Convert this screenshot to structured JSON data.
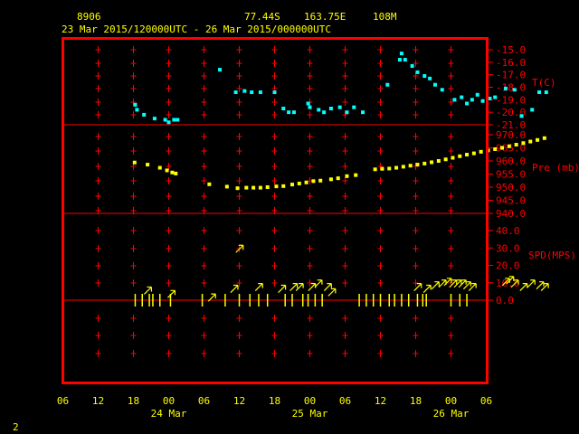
{
  "header": {
    "station_id": "8906",
    "lat": "77.44S",
    "lon": "163.75E",
    "elevation": "108M",
    "time_range": "23 Mar 2015/120000UTC - 26 Mar 2015/000000UTC"
  },
  "page_number": "2",
  "colors": {
    "frame": "#ff0000",
    "text": "#ffff00",
    "temperature": "#00ffff",
    "pressure": "#ffff00",
    "wind": "#ffff00",
    "background": "#000000"
  },
  "x_axis": {
    "hour_ticks": [
      "06",
      "12",
      "18",
      "00",
      "06",
      "12",
      "18",
      "00",
      "06",
      "12",
      "18",
      "00",
      "06"
    ],
    "day_labels": [
      "24 Mar",
      "25 Mar",
      "26 Mar"
    ]
  },
  "chart_data": [
    {
      "type": "scatter",
      "panel": "temperature",
      "ylabel": "T(C)",
      "ylim": [
        -21,
        -15
      ],
      "yticks": [
        "-15.0",
        "-16.0",
        "-17.0",
        "-18.0",
        "-19.0",
        "-20.0",
        "-21.0"
      ],
      "x_unit": "hours from 23 Mar 2015 06 UTC",
      "points": [
        [
          12.3,
          -19.4
        ],
        [
          12.6,
          -19.8
        ],
        [
          13.8,
          -20.2
        ],
        [
          15.6,
          -20.5
        ],
        [
          17.4,
          -20.6
        ],
        [
          18.0,
          -20.8
        ],
        [
          18.9,
          -20.6
        ],
        [
          19.5,
          -20.6
        ],
        [
          26.7,
          -16.6
        ],
        [
          29.4,
          -18.4
        ],
        [
          30.9,
          -18.3
        ],
        [
          32.1,
          -18.4
        ],
        [
          33.6,
          -18.4
        ],
        [
          36.0,
          -18.4
        ],
        [
          37.5,
          -19.7
        ],
        [
          38.4,
          -20.0
        ],
        [
          39.3,
          -20.0
        ],
        [
          41.7,
          -19.3
        ],
        [
          42.0,
          -19.6
        ],
        [
          43.5,
          -19.8
        ],
        [
          44.4,
          -20.0
        ],
        [
          45.6,
          -19.7
        ],
        [
          47.1,
          -19.6
        ],
        [
          48.3,
          -20.0
        ],
        [
          49.5,
          -19.6
        ],
        [
          51.0,
          -20.0
        ],
        [
          55.2,
          -17.8
        ],
        [
          57.3,
          -15.8
        ],
        [
          57.6,
          -15.3
        ],
        [
          58.2,
          -15.8
        ],
        [
          59.4,
          -16.3
        ],
        [
          60.3,
          -16.8
        ],
        [
          61.5,
          -17.1
        ],
        [
          62.4,
          -17.3
        ],
        [
          63.3,
          -17.8
        ],
        [
          64.5,
          -18.2
        ],
        [
          66.6,
          -19.0
        ],
        [
          67.8,
          -18.8
        ],
        [
          68.7,
          -19.3
        ],
        [
          69.6,
          -19.0
        ],
        [
          70.5,
          -18.6
        ],
        [
          71.4,
          -19.1
        ],
        [
          72.6,
          -18.9
        ],
        [
          73.5,
          -18.8
        ],
        [
          75.3,
          -18.1
        ],
        [
          76.8,
          -18.2
        ],
        [
          78.0,
          -20.3
        ],
        [
          79.8,
          -19.8
        ],
        [
          81.0,
          -18.4
        ],
        [
          82.2,
          -18.4
        ]
      ]
    },
    {
      "type": "scatter",
      "panel": "pressure",
      "ylabel": "Pre (mb)",
      "ylim": [
        940,
        970
      ],
      "yticks": [
        "970.0",
        "965.0",
        "960.0",
        "955.0",
        "950.0",
        "945.0",
        "940.0"
      ],
      "x_unit": "hours from 23 Mar 2015 06 UTC",
      "points": [
        [
          12.2,
          959.4
        ],
        [
          14.4,
          958.6
        ],
        [
          16.5,
          957.4
        ],
        [
          17.7,
          956.4
        ],
        [
          18.6,
          955.6
        ],
        [
          19.2,
          955.2
        ],
        [
          24.9,
          951.1
        ],
        [
          27.9,
          950.2
        ],
        [
          29.7,
          949.6
        ],
        [
          31.2,
          949.8
        ],
        [
          32.4,
          949.8
        ],
        [
          33.6,
          949.8
        ],
        [
          34.8,
          950.0
        ],
        [
          36.3,
          950.3
        ],
        [
          37.5,
          950.4
        ],
        [
          39.0,
          951.0
        ],
        [
          40.2,
          951.4
        ],
        [
          41.4,
          951.8
        ],
        [
          42.6,
          952.3
        ],
        [
          43.8,
          952.5
        ],
        [
          45.6,
          953.0
        ],
        [
          46.8,
          953.4
        ],
        [
          48.3,
          954.2
        ],
        [
          49.8,
          954.6
        ],
        [
          53.1,
          956.8
        ],
        [
          54.3,
          957.0
        ],
        [
          55.5,
          957.1
        ],
        [
          56.7,
          957.4
        ],
        [
          57.9,
          957.8
        ],
        [
          59.1,
          958.2
        ],
        [
          60.3,
          958.6
        ],
        [
          61.5,
          959.0
        ],
        [
          62.7,
          959.5
        ],
        [
          63.9,
          960.0
        ],
        [
          65.1,
          960.6
        ],
        [
          66.3,
          961.2
        ],
        [
          67.5,
          961.8
        ],
        [
          68.7,
          962.4
        ],
        [
          69.9,
          962.9
        ],
        [
          71.1,
          963.5
        ],
        [
          72.3,
          964.0
        ],
        [
          73.5,
          964.5
        ],
        [
          74.7,
          965.0
        ],
        [
          75.9,
          965.6
        ],
        [
          77.1,
          966.2
        ],
        [
          78.3,
          966.8
        ],
        [
          79.5,
          967.4
        ],
        [
          80.7,
          968.0
        ],
        [
          81.9,
          968.7
        ]
      ]
    },
    {
      "type": "scatter",
      "panel": "wind",
      "ylabel": "SPD(MPS)",
      "ylim": [
        0,
        40
      ],
      "yticks": [
        "40.0",
        "30.0",
        "20.0",
        "10.0",
        "0.0"
      ],
      "x_unit": "hours from 23 Mar 2015 06 UTC",
      "barb_hours": [
        12.3,
        13.5,
        14.7,
        15.3,
        16.5,
        18.3,
        23.7,
        27.6,
        30.0,
        31.8,
        33.3,
        34.8,
        37.8,
        39.0,
        40.8,
        41.7,
        42.9,
        44.1,
        50.4,
        51.6,
        52.8,
        54.0,
        55.5,
        56.4,
        57.6,
        58.8,
        60.3,
        61.2,
        61.8,
        66.0,
        67.5,
        68.7
      ],
      "barb_speeds": [
        0,
        8,
        0,
        0,
        0,
        0,
        0,
        0,
        0,
        8,
        6,
        0,
        5,
        12,
        10,
        12,
        0,
        10,
        0,
        0,
        0,
        0,
        0,
        0,
        0,
        0,
        0,
        0,
        0,
        0,
        0,
        0
      ],
      "arrows": [
        [
          14.6,
          6
        ],
        [
          18.6,
          4
        ],
        [
          25.5,
          2
        ],
        [
          29.3,
          7
        ],
        [
          30.2,
          30
        ],
        [
          33.5,
          8
        ],
        [
          37.4,
          7
        ],
        [
          39.4,
          8
        ],
        [
          40.4,
          8
        ],
        [
          42.5,
          8
        ],
        [
          43.6,
          10
        ],
        [
          45.2,
          8
        ],
        [
          45.9,
          5
        ],
        [
          60.5,
          8
        ],
        [
          62.1,
          7
        ],
        [
          63.5,
          9
        ],
        [
          64.7,
          10
        ],
        [
          65.6,
          11
        ],
        [
          66.5,
          10
        ],
        [
          67.3,
          10
        ],
        [
          68.1,
          10
        ],
        [
          68.9,
          9
        ],
        [
          69.8,
          8
        ],
        [
          75.5,
          11
        ],
        [
          76.2,
          12
        ],
        [
          77.0,
          10
        ],
        [
          78.5,
          8
        ],
        [
          79.8,
          10
        ],
        [
          81.3,
          9
        ],
        [
          82.1,
          8
        ]
      ]
    }
  ]
}
